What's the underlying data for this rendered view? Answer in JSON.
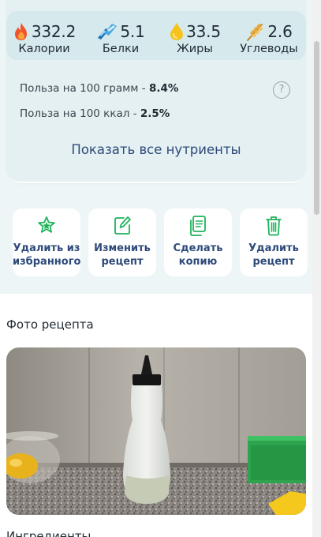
{
  "macros": [
    {
      "icon": "fire-icon",
      "value": "332.2",
      "label": "Калории"
    },
    {
      "icon": "protein-icon",
      "value": "5.1",
      "label": "Белки"
    },
    {
      "icon": "oil-drop-icon",
      "value": "33.5",
      "label": "Жиры"
    },
    {
      "icon": "wheat-icon",
      "value": "2.6",
      "label": "Углеводы"
    }
  ],
  "benefit": {
    "per_100g_label": "Польза на 100 грамм - ",
    "per_100g_value": "8.4%",
    "per_100kcal_label": "Польза на 100 ккал - ",
    "per_100kcal_value": "2.5%",
    "help_glyph": "?"
  },
  "show_all_label": "Показать все нутриенты",
  "actions": [
    {
      "icon": "star-icon",
      "line1": "Удалить из",
      "line2": "избранного"
    },
    {
      "icon": "edit-icon",
      "line1": "Изменить",
      "line2": "рецепт"
    },
    {
      "icon": "copy-icon",
      "line1": "Сделать",
      "line2": "копию"
    },
    {
      "icon": "trash-icon",
      "line1": "Удалить",
      "line2": "рецепт"
    }
  ],
  "photo_section_title": "Фото рецепта",
  "ingredients_title": "Ингредиенты",
  "colors": {
    "accent_green": "#1fb35a",
    "link_blue": "#2e4a7a",
    "panel_bg": "#e4f0f2"
  }
}
